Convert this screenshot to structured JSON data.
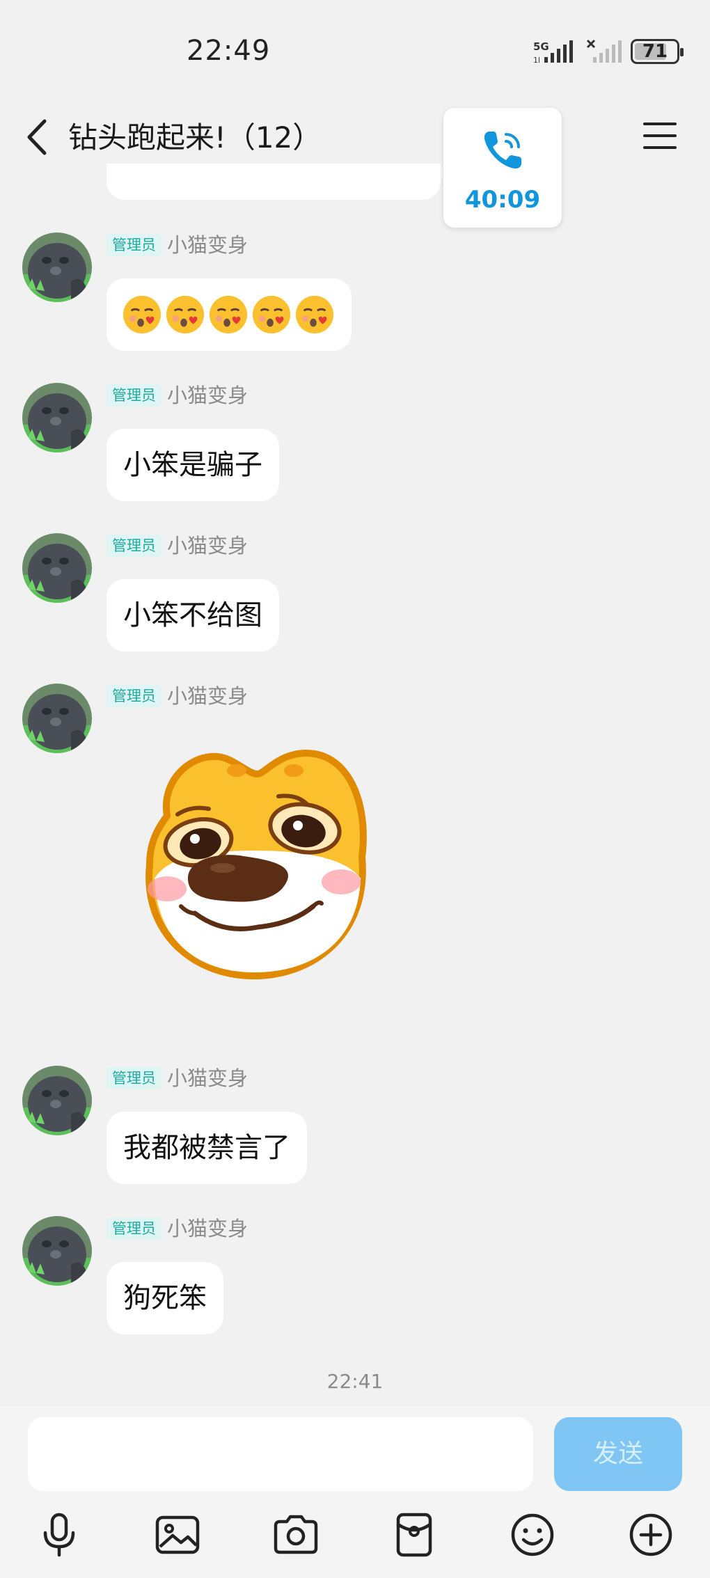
{
  "status_bar": {
    "time": "22:49",
    "network": "5G",
    "battery": "71",
    "battery_level_percent": 71
  },
  "header": {
    "title": "钻头跑起来!（12）"
  },
  "call": {
    "duration": "40:09"
  },
  "messages": [
    {
      "badge": "管理员",
      "nickname": "小猫变身",
      "emoji_count": 5,
      "emoji": "kissing-face-with-heart"
    },
    {
      "badge": "管理员",
      "nickname": "小猫变身",
      "text": "小笨是骗子"
    },
    {
      "badge": "管理员",
      "nickname": "小猫变身",
      "text": "小笨不给图"
    },
    {
      "badge": "管理员",
      "nickname": "小猫变身",
      "sticker": "pleading-dog-sticker"
    },
    {
      "badge": "管理员",
      "nickname": "小猫变身",
      "text": "我都被禁言了"
    },
    {
      "badge": "管理员",
      "nickname": "小猫变身",
      "text": "狗死笨"
    }
  ],
  "timestamp": "22:41",
  "input": {
    "value": "",
    "placeholder": "",
    "send_label": "发送"
  },
  "toolbar": [
    "microphone-icon",
    "image-icon",
    "camera-icon",
    "red-packet-icon",
    "emoji-icon",
    "plus-icon"
  ],
  "colors": {
    "accent": "#1296db",
    "badge_text": "#1eaaa0",
    "badge_bg": "#dff5f3",
    "send_disabled": "#7fc6f4",
    "background": "#f1f1f1"
  }
}
